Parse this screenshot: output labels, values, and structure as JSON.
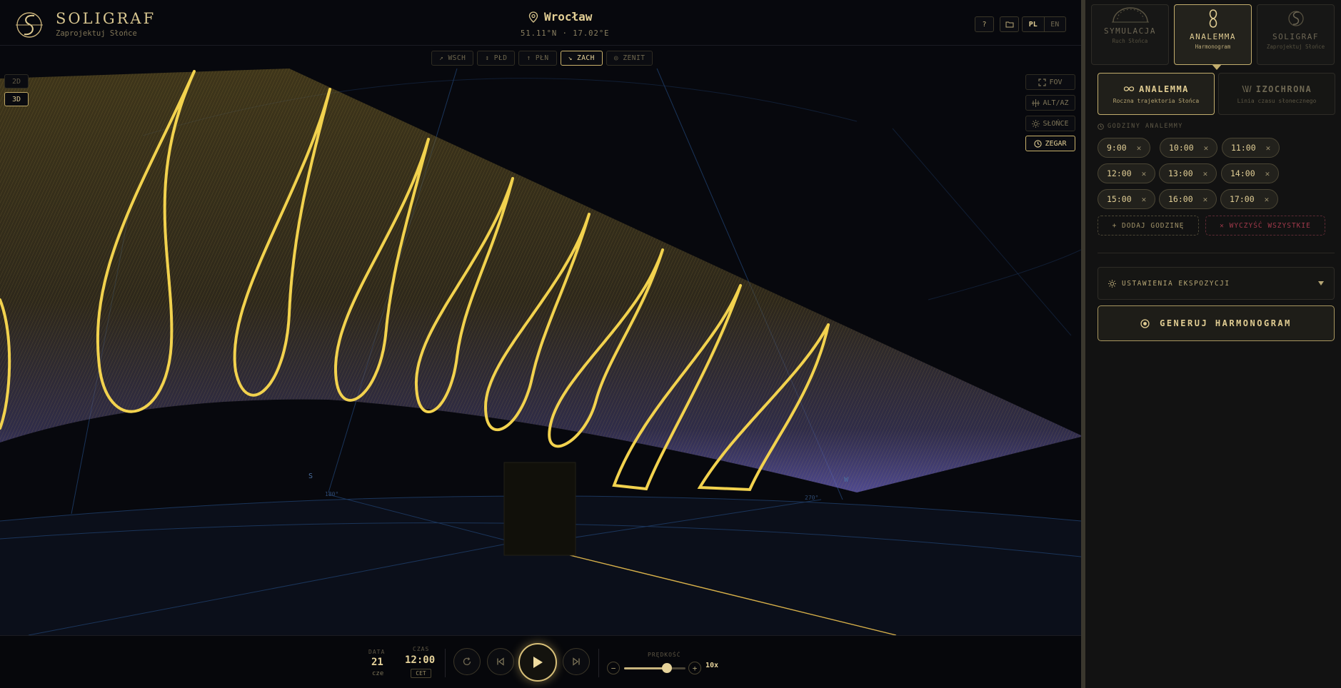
{
  "app": {
    "brand": "SOLIGRAF",
    "brand_sub": "Zaprojektuj Słońce"
  },
  "location": {
    "name": "Wrocław",
    "coords": "51.11°N · 17.02°E"
  },
  "topbar": {
    "help": "?",
    "lang_pl": "PL",
    "lang_en": "EN"
  },
  "views": [
    "↗ WSCH",
    "↕ PŁD",
    "↑ PŁN",
    "↘ ZACH",
    "◎ ZENIT"
  ],
  "active_view": "↘ ZACH",
  "dims": {
    "d2": "2D",
    "d3": "3D",
    "active": "3D"
  },
  "tools": {
    "fov": "FOV",
    "altaz": "ALT/AZ",
    "sun": "SŁOŃCE",
    "clock": "ZEGAR"
  },
  "scene": {
    "cardinal_s": "S",
    "cardinal_w": "W",
    "az_s": "180°",
    "az_w": "270°"
  },
  "playback": {
    "date_label": "DATA",
    "date_value": "21",
    "date_day": "cze",
    "time_label": "CZAS",
    "time_value": "12:00",
    "timezone": "CET",
    "speed_label": "PRĘDKOŚĆ",
    "speed_value": "10x",
    "speed_fraction": 0.7
  },
  "panel": {
    "modes": [
      {
        "title": "SYMULACJA",
        "sub": "Ruch Słońca",
        "active": false
      },
      {
        "title": "ANALEMMA",
        "sub": "Harmonogram",
        "active": true
      },
      {
        "title": "SOLIGRAF",
        "sub": "Zaprojektuj Słońce",
        "active": false
      }
    ],
    "submodes": [
      {
        "title": "ANALEMMA",
        "sub": "Roczna trajektoria Słońca",
        "active": true
      },
      {
        "title": "IZOCHRONA",
        "sub": "Linia czasu słonecznego",
        "active": false
      }
    ],
    "hours_label": "GODZINY ANALEMMY",
    "hours": [
      "9:00",
      "10:00",
      "11:00",
      "12:00",
      "13:00",
      "14:00",
      "15:00",
      "16:00",
      "17:00"
    ],
    "add_hour": "+ DODAJ GODZINĘ",
    "clear_all": "✕ WYCZYŚĆ WSZYSTKIE",
    "exposure": "USTAWIENIA EKSPOZYCJI",
    "generate": "GENERUJ HARMONOGRAM"
  },
  "colors": {
    "accent": "#e6d39b",
    "analemma": "#f2d24e",
    "danger": "#a0394a",
    "grid": "#1d3a63"
  }
}
